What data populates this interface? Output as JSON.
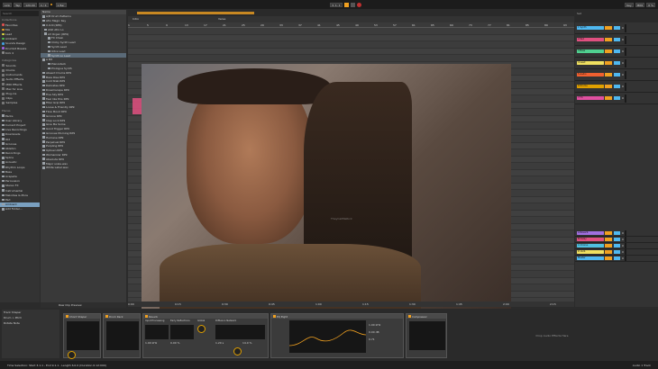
{
  "transport": {
    "tempo": "120.00",
    "time_sig": "4 / 4",
    "metronome": "1 Bar",
    "position": "3. 1. 1",
    "key_label": "Key",
    "midi_label": "MIDI",
    "cpu": "0 %"
  },
  "browser": {
    "search_placeholder": "Search",
    "collections_header": "Collections",
    "collections": [
      {
        "label": "Favorites",
        "color": "#e05050"
      },
      {
        "label": "Mix",
        "color": "#f0a020"
      },
      {
        "label": "Lead",
        "color": "#e0e040"
      },
      {
        "label": "Ambient",
        "color": "#50c050"
      },
      {
        "label": "Sounds Design",
        "color": "#40a0e0"
      },
      {
        "label": "Drumkit Breaks",
        "color": "#a060e0"
      },
      {
        "label": "Kick 4",
        "color": "#888888"
      }
    ],
    "categories_header": "Categories",
    "categories": [
      "Sounds",
      "Drums",
      "Instruments",
      "Audio Effects",
      "MIDI Effects",
      "Max for Live",
      "Plug-ins",
      "Clips",
      "Samples"
    ],
    "places_header": "Places",
    "places": [
      "Packs",
      "User Library",
      "Current Project",
      "Live Recordings",
      "Downloads",
      "Old",
      "Grooves",
      "Ableton",
      "Recordings",
      "Splice",
      "Acoustic",
      "Rhythm Loops",
      "Bass",
      "Acapella",
      "Percussion",
      "Stereo FX",
      "Instrumental",
      "Melodies & More",
      "Pad",
      "Ambient",
      "Add Folder..."
    ],
    "col_name": "Name",
    "files": [
      "A/B Drum Patterns",
      "Afro Magic Key",
      "X.O.N (RP9)",
      "ASD Afro Lo",
      "A3 Organ (RP9)",
      "FX Chain",
      "Clicky Synth Lead",
      "Synth Lead",
      "Ultra Lead",
      "Synth Lo Lead",
      "A Bit",
      "Pianostack",
      "Prologue Synth",
      "Absent Drums RP9",
      "Bass Rise RP9",
      "Cold Stab RP9",
      "Delicates RP9",
      "Dreamscape RP9",
      "Five Sky RP9",
      "Feel like this RP9",
      "Filler Grip RP9",
      "Loose & Friendly RP9",
      "Flow Mood RP9",
      "Groove RP9",
      "Clap Lock RP9",
      "Give Me Some",
      "Good Trigger RP9",
      "Grooves Morning RP9",
      "Humane RP9",
      "Perpetual RP9",
      "Purpling RP9",
      "Uptown RP9",
      "Womanizer RP9",
      "Absolute RP9",
      "Major scale.wav",
      "White Label.wav"
    ],
    "preview_label": "Raw Clip Preview"
  },
  "arrangement": {
    "markers": [
      "Intro",
      "Verse"
    ],
    "ruler": [
      "1",
      "5",
      "9",
      "13",
      "17",
      "21",
      "25",
      "29",
      "33",
      "37",
      "41",
      "45",
      "49",
      "53",
      "57",
      "61",
      "65",
      "69",
      "73",
      "77",
      "81",
      "85",
      "89",
      "93"
    ],
    "bottom_times": [
      "0:00",
      "0:15",
      "0:30",
      "0:45",
      "1:00",
      "1:15",
      "1:30",
      "1:45",
      "2:00",
      "2:15"
    ]
  },
  "image": {
    "description": "dwayne-johnson-smirk-photo",
    "watermark": "TheyCallMeRick"
  },
  "mixer": {
    "master_label": "Set",
    "tracks": [
      {
        "name": "1 Synth",
        "color": "#4fb8f0",
        "vol": "0"
      },
      {
        "name": "2 Pad",
        "color": "#e05080",
        "vol": "0"
      },
      {
        "name": "3 Bass",
        "color": "#50d090",
        "vol": "0"
      },
      {
        "name": "4 Lead",
        "color": "#f0e060",
        "vol": "0"
      },
      {
        "name": "5 Audio",
        "color": "#f06030",
        "vol": "0"
      },
      {
        "name": "6 Drums",
        "color": "#e0a000",
        "vol": "0"
      },
      {
        "name": "7 FX",
        "color": "#e050a0",
        "vol": "0"
      },
      {
        "name": "A Reverb",
        "color": "#a070e0",
        "vol": "0"
      },
      {
        "name": "B Delay",
        "color": "#e05080",
        "vol": "0"
      },
      {
        "name": "C Chorus",
        "color": "#50c0e0",
        "vol": "0"
      },
      {
        "name": "D Verb",
        "color": "#f0e060",
        "vol": "0"
      },
      {
        "name": "Master",
        "color": "#4fb8f0",
        "vol": "0"
      }
    ]
  },
  "devices": [
    {
      "title": "Chord Shaper",
      "params": [
        "Shape",
        "Amount",
        "Pitch"
      ]
    },
    {
      "title": "Drum Rack",
      "params": [
        "Macro 1",
        "Macro 2"
      ]
    },
    {
      "title": "Reverb",
      "params": [
        "Input Processing",
        "Early Reflections",
        "Global",
        "Diffusion Network"
      ],
      "values": [
        "1.00 kHz",
        "0.00 %",
        "1.20 s",
        "14.0 %"
      ]
    },
    {
      "title": "EQ Eight",
      "params": [
        "Freq",
        "Gain",
        "Q"
      ],
      "values": [
        "1.00 kHz",
        "0.00 dB",
        "0.71"
      ]
    },
    {
      "title": "Compressor",
      "params": [
        "Thresh",
        "Ratio"
      ]
    }
  ],
  "drop_hint": "Drop Audio Effects Here",
  "status": {
    "left": "Time Selection: Start 3.1.1 - End 9.1.1 - Length 6.0.0 (Duration 0:12:000)",
    "right": "Audio 1 Track"
  }
}
